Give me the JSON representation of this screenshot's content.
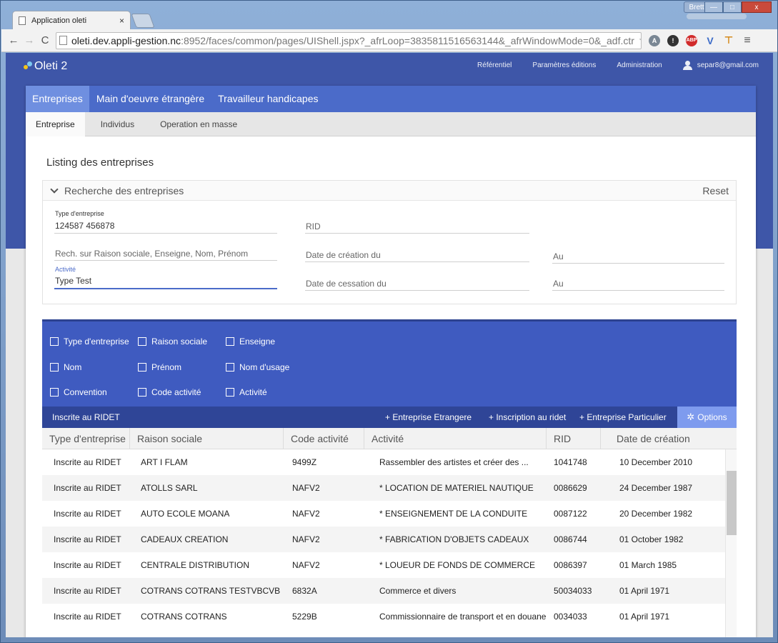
{
  "browser": {
    "tab_title": "Application oleti",
    "tab_close": "×",
    "user_pill": "Brett",
    "url_host": "oleti.dev.appli-gestion.nc",
    "url_rest": ":8952/faces/common/pages/UIShell.jspx?_afrLoop=3835811516563144&_afrWindowMode=0&_adf.ctr",
    "back": "←",
    "forward": "→",
    "reload": "C",
    "menu": "≡",
    "win_minimize": "—",
    "win_maximize": "□",
    "win_close": "x"
  },
  "app": {
    "logo": "Oleti 2",
    "nav": [
      "Référentiel",
      "Paramètres éditions",
      "Administration"
    ],
    "user_email": "separ8@gmail.com",
    "main_tabs": [
      "Entreprises",
      "Main d'oeuvre étrangère",
      "Travailleur handicapes"
    ],
    "sub_tabs": [
      "Entreprise",
      "Individus",
      "Operation en masse"
    ],
    "page_title": "Listing des entreprises"
  },
  "search": {
    "header": "Recherche des entreprises",
    "reset": "Reset",
    "type_label": "Type d'entreprise",
    "type_value": "124587 456878",
    "rid_placeholder": "RID",
    "rech_placeholder": "Rech. sur Raison sociale, Enseigne, Nom, Prénom",
    "date_creation_placeholder": "Date de création du",
    "au1_placeholder": "Au",
    "activite_label": "Activité",
    "activite_value": "Type Test",
    "date_cessation_placeholder": "Date de cessation du",
    "au2_placeholder": "Au"
  },
  "columns_picker": [
    "Type d'entreprise",
    "Raison sociale",
    "Enseigne",
    "Nom",
    "Prénom",
    "Nom d'usage",
    "Convention",
    "Code activité",
    "Activité"
  ],
  "grid": {
    "title": "Inscrite au RIDET",
    "actions": [
      "+ Entreprise Etrangere",
      "+ Inscription au ridet",
      "+ Entreprise Particulier"
    ],
    "options": "Options",
    "headers": [
      "Type d'entreprise",
      "Raison sociale",
      "Code activité",
      "Activité",
      "RID",
      "Date de création"
    ],
    "rows": [
      [
        "Inscrite au RIDET",
        "ART I FLAM",
        "9499Z",
        "Rassembler des artistes et créer des ...",
        "1041748",
        "10 December 2010"
      ],
      [
        "Inscrite au RIDET",
        "ATOLLS SARL",
        "NAFV2",
        "* LOCATION DE MATERIEL NAUTIQUE",
        "0086629",
        "24 December 1987"
      ],
      [
        "Inscrite au RIDET",
        "AUTO ECOLE MOANA",
        "NAFV2",
        "* ENSEIGNEMENT DE LA CONDUITE",
        "0087122",
        "20 December 1982"
      ],
      [
        "Inscrite au RIDET",
        "CADEAUX CREATION",
        "NAFV2",
        "* FABRICATION D'OBJETS CADEAUX",
        "0086744",
        "01 October 1982"
      ],
      [
        "Inscrite au RIDET",
        "CENTRALE DISTRIBUTION",
        "NAFV2",
        "* LOUEUR DE FONDS DE COMMERCE",
        "0086397",
        "01 March 1985"
      ],
      [
        "Inscrite au RIDET",
        "COTRANS COTRANS TESTVBCVB",
        "6832A",
        "Commerce et divers",
        "50034033",
        "01 April 1971"
      ],
      [
        "Inscrite au RIDET",
        "COTRANS COTRANS",
        "5229B",
        "Commissionnaire de transport et en douane",
        "0034033",
        "01 April 1971"
      ]
    ]
  },
  "colors": {
    "primary": "#4b6bc9",
    "active_tab": "#6f8fe0",
    "grid_bar": "#2f4597",
    "options": "#7e9bee"
  }
}
